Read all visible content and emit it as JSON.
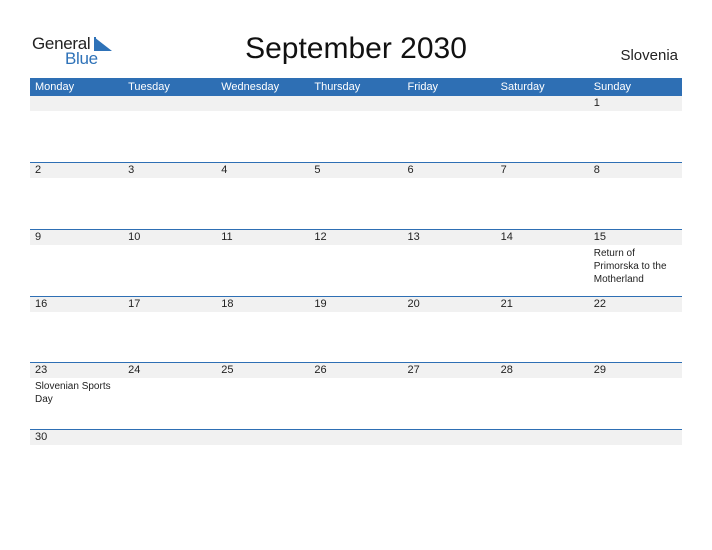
{
  "logo": {
    "general": "General",
    "blue": "Blue"
  },
  "title": "September 2030",
  "country": "Slovenia",
  "colors": {
    "accent": "#2e6fb4",
    "strip": "#f1f1f1"
  },
  "weekdays": [
    "Monday",
    "Tuesday",
    "Wednesday",
    "Thursday",
    "Friday",
    "Saturday",
    "Sunday"
  ],
  "weeks": [
    [
      {
        "day": ""
      },
      {
        "day": ""
      },
      {
        "day": ""
      },
      {
        "day": ""
      },
      {
        "day": ""
      },
      {
        "day": ""
      },
      {
        "day": "1"
      }
    ],
    [
      {
        "day": "2"
      },
      {
        "day": "3"
      },
      {
        "day": "4"
      },
      {
        "day": "5"
      },
      {
        "day": "6"
      },
      {
        "day": "7"
      },
      {
        "day": "8"
      }
    ],
    [
      {
        "day": "9"
      },
      {
        "day": "10"
      },
      {
        "day": "11"
      },
      {
        "day": "12"
      },
      {
        "day": "13"
      },
      {
        "day": "14"
      },
      {
        "day": "15",
        "holiday": "Return of Primorska to the Motherland"
      }
    ],
    [
      {
        "day": "16"
      },
      {
        "day": "17"
      },
      {
        "day": "18"
      },
      {
        "day": "19"
      },
      {
        "day": "20"
      },
      {
        "day": "21"
      },
      {
        "day": "22"
      }
    ],
    [
      {
        "day": "23",
        "holiday": "Slovenian Sports Day"
      },
      {
        "day": "24"
      },
      {
        "day": "25"
      },
      {
        "day": "26"
      },
      {
        "day": "27"
      },
      {
        "day": "28"
      },
      {
        "day": "29"
      }
    ],
    [
      {
        "day": "30"
      },
      {
        "day": ""
      },
      {
        "day": ""
      },
      {
        "day": ""
      },
      {
        "day": ""
      },
      {
        "day": ""
      },
      {
        "day": ""
      }
    ]
  ]
}
